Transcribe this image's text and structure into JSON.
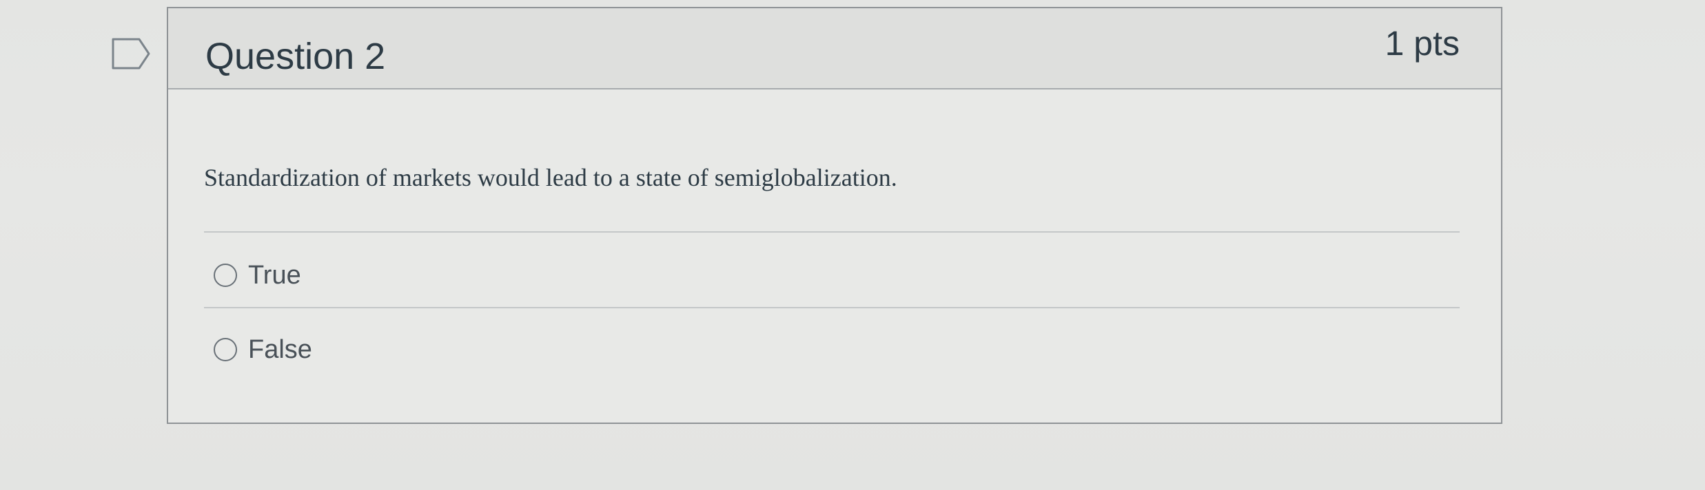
{
  "question": {
    "title": "Question 2",
    "points": "1 pts",
    "text": "Standardization of markets would lead to a state of semiglobalization.",
    "flag_icon": "bookmark-flag-icon",
    "answers": [
      {
        "label": "True",
        "selected": false
      },
      {
        "label": "False",
        "selected": false
      }
    ]
  },
  "colors": {
    "page_background": "#e4e5e3",
    "card_border": "#8f9396",
    "text": "#2d3b45",
    "radio_border": "#687077"
  }
}
